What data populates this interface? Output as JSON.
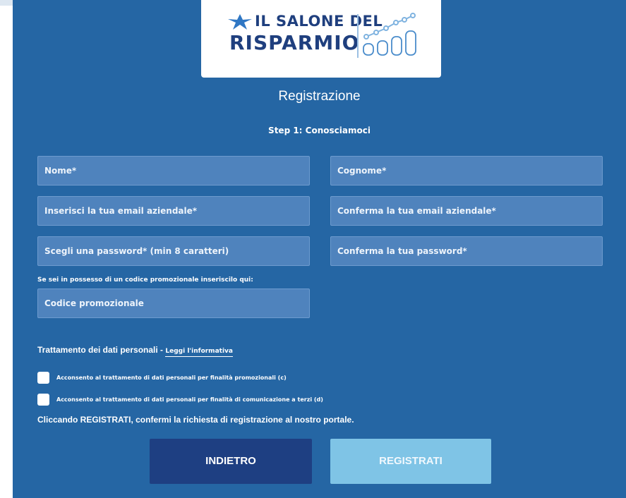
{
  "logo": {
    "line1": "IL SALONE DEL",
    "line2": "RISPARMIO"
  },
  "page": {
    "title": "Registrazione",
    "step": "Step 1: Conosciamoci"
  },
  "form": {
    "nome_placeholder": "Nome*",
    "cognome_placeholder": "Cognome*",
    "email_placeholder": "Inserisci la tua email aziendale*",
    "email_confirm_placeholder": "Conferma la tua email aziendale*",
    "password_placeholder": "Scegli una password* (min 8 caratteri)",
    "password_confirm_placeholder": "Conferma la tua password*",
    "promo_label": "Se sei in possesso di un codice promozionale inseriscilo qui:",
    "promo_placeholder": "Codice promozionale"
  },
  "privacy": {
    "title": "Trattamento dei dati personali - ",
    "link": "Leggi l'informativa",
    "consent_c": "Acconsento al trattamento di dati personali per finalità promozionali (c)",
    "consent_d": "Acconsento al trattamento di dati personali per finalità di comunicazione a terzi (d)",
    "confirm_text": "Cliccando REGISTRATI, confermi la richiesta di registrazione al nostro portale."
  },
  "buttons": {
    "back": "INDIETRO",
    "register": "REGISTRATI"
  },
  "colors": {
    "background": "#2566a4",
    "field": "#4f83bd",
    "back_button": "#1e3f82",
    "register_button": "#7fc4e6"
  }
}
